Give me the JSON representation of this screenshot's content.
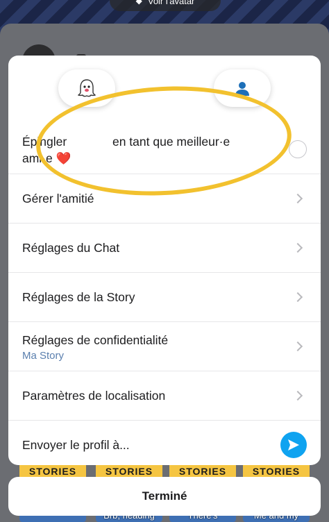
{
  "background": {
    "avatar_button_label": "Voir l'avatar",
    "thumbnails": [
      {
        "band": "STORIES",
        "caption": ""
      },
      {
        "band": "STORIES",
        "caption": "Brb, heading"
      },
      {
        "band": "STORIES",
        "caption": "There's"
      },
      {
        "band": "STORIES",
        "caption": "Me and my"
      }
    ]
  },
  "sheet": {
    "top_buttons": [
      {
        "icon": "ghost-icon"
      },
      {
        "icon": "person-icon"
      }
    ],
    "highlight_color": "#f2c12e",
    "pin_row": {
      "label_start": "Épingler",
      "label_end": "en tant que meilleur·e ami·e ❤️"
    },
    "rows": [
      {
        "label": "Gérer l'amitié",
        "sub": ""
      },
      {
        "label": "Réglages du Chat",
        "sub": ""
      },
      {
        "label": "Réglages de la Story",
        "sub": ""
      },
      {
        "label": "Réglages de confidentialité",
        "sub": "Ma Story"
      },
      {
        "label": "Paramètres de localisation",
        "sub": ""
      }
    ],
    "send_row": {
      "label": "Envoyer le profil à..."
    }
  },
  "done_label": "Terminé",
  "colors": {
    "accent_blue": "#0fa3f0",
    "subtitle_blue": "#5a7fae",
    "highlight_yellow": "#f2c12e"
  }
}
